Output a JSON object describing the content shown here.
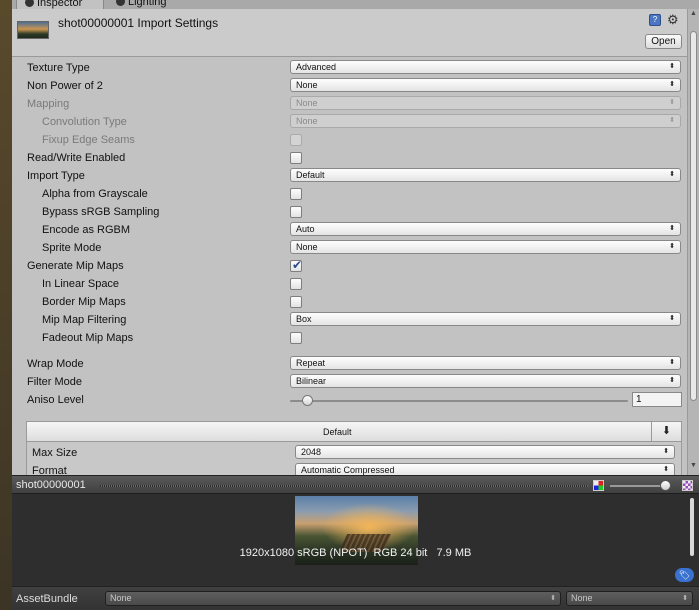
{
  "tabs": [
    {
      "label": "Inspector",
      "icon": "info-icon"
    },
    {
      "label": "Lighting",
      "icon": "lighting-icon"
    }
  ],
  "header": {
    "title": "shot00000001 Import Settings",
    "open_label": "Open",
    "help_glyph": "?",
    "gear_glyph": "⚙"
  },
  "settings": {
    "texture_type": {
      "label": "Texture Type",
      "value": "Advanced"
    },
    "non_power_of_2": {
      "label": "Non Power of 2",
      "value": "None"
    },
    "mapping": {
      "label": "Mapping",
      "value": "None"
    },
    "convolution_type": {
      "label": "Convolution Type",
      "value": "None"
    },
    "fixup_edge_seams": {
      "label": "Fixup Edge Seams",
      "checked": false
    },
    "read_write_enabled": {
      "label": "Read/Write Enabled",
      "checked": false
    },
    "import_type": {
      "label": "Import Type",
      "value": "Default"
    },
    "alpha_from_grayscale": {
      "label": "Alpha from Grayscale",
      "checked": false
    },
    "bypass_srgb": {
      "label": "Bypass sRGB Sampling",
      "checked": false
    },
    "encode_as_rgbm": {
      "label": "Encode as RGBM",
      "value": "Auto"
    },
    "sprite_mode": {
      "label": "Sprite Mode",
      "value": "None"
    },
    "generate_mip_maps": {
      "label": "Generate Mip Maps",
      "checked": true
    },
    "in_linear_space": {
      "label": "In Linear Space",
      "checked": false
    },
    "border_mip_maps": {
      "label": "Border Mip Maps",
      "checked": false
    },
    "mip_map_filtering": {
      "label": "Mip Map Filtering",
      "value": "Box"
    },
    "fadeout_mip_maps": {
      "label": "Fadeout Mip Maps",
      "checked": false
    },
    "wrap_mode": {
      "label": "Wrap Mode",
      "value": "Repeat"
    },
    "filter_mode": {
      "label": "Filter Mode",
      "value": "Bilinear"
    },
    "aniso_level": {
      "label": "Aniso Level",
      "value": "1",
      "slider_fraction": 0.05
    }
  },
  "platform": {
    "tab_label": "Default",
    "download_glyph": "⬇",
    "max_size": {
      "label": "Max Size",
      "value": "2048"
    },
    "format": {
      "label": "Format",
      "value": "Automatic Compressed"
    }
  },
  "preview": {
    "title": "shot00000001",
    "info": "1920x1080 sRGB (NPOT)  RGB 24 bit   7.9 MB",
    "zoom_fraction": 0.95
  },
  "assetbundle": {
    "label": "AssetBundle",
    "name_value": "None",
    "variant_value": "None"
  },
  "glyphs": {
    "dropdown_arrow": "⬍",
    "scroll_up": "▲",
    "scroll_down": "▼"
  }
}
